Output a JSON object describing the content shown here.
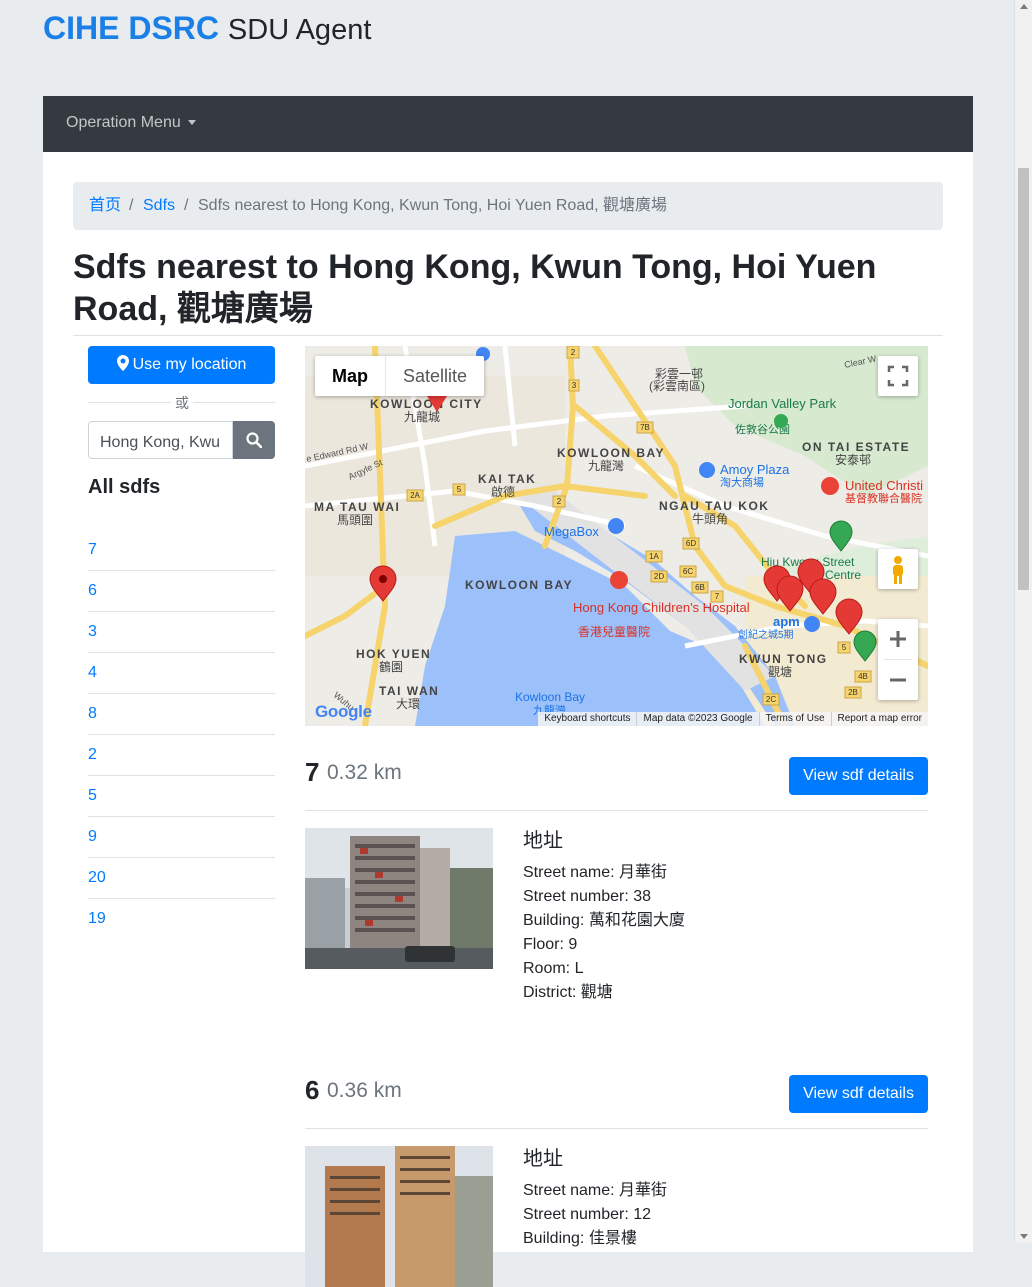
{
  "brand": {
    "primary": "CIHE DSRC",
    "secondary": "SDU Agent"
  },
  "navbar": {
    "menu_label": "Operation Menu"
  },
  "breadcrumb": {
    "home": "首页",
    "sdfs": "Sdfs",
    "current": "Sdfs nearest to Hong Kong, Kwun Tong, Hoi Yuen Road, 觀塘廣場",
    "separator": "/"
  },
  "page_title": "Sdfs nearest to Hong Kong, Kwun Tong, Hoi Yuen Road, 觀塘廣場",
  "sidebar": {
    "use_location_label": "Use my location",
    "or_label": "或",
    "search_value": "Hong Kong, Kwun Tong, Hoi Yuen Road, 觀塘廣場",
    "all_sdfs_label": "All sdfs",
    "sdf_links": [
      "7",
      "6",
      "3",
      "4",
      "8",
      "2",
      "5",
      "9",
      "20",
      "19"
    ]
  },
  "map": {
    "map_tab": "Map",
    "satellite_tab": "Satellite",
    "google_logo": "Google",
    "keyboard_shortcuts": "Keyboard shortcuts",
    "map_data": "Map data ©2023 Google",
    "terms": "Terms of Use",
    "report": "Report a map error",
    "labels": {
      "kowloon_city": "KOWLOON CITY",
      "kowloon_city_zh": "九龍城",
      "kai_tak": "KAI TAK",
      "kai_tak_zh": "啟德",
      "kowloon_bay": "KOWLOON BAY",
      "kowloon_bay_zh": "九龍灣",
      "ma_tau_wai": "MA TAU WAI",
      "ma_tau_wai_zh": "馬頭圍",
      "ngau_tau_kok": "NGAU TAU KOK",
      "ngau_tau_kok_zh": "牛頭角",
      "kowloon_bay_water": "KOWLOON BAY",
      "hok_yuen": "HOK YUEN",
      "hok_yuen_zh": "鶴園",
      "tai_wan": "TAI WAN",
      "tai_wan_zh": "大環",
      "kwun_tong": "KWUN TONG",
      "kwun_tong_zh": "觀塘",
      "on_tai_estate": "ON TAI ESTATE",
      "on_tai_estate_zh": "安泰邨",
      "jordan_valley_park": "Jordan Valley Park",
      "jordan_valley_park_zh": "佐敦谷公園",
      "amoy_plaza": "Amoy Plaza",
      "amoy_plaza_zh": "淘大商場",
      "megabox": "MegaBox",
      "hk_childrens_hospital": "Hong Kong Children's Hospital",
      "hk_childrens_hospital_zh": "香港兒童醫院",
      "apm": "apm",
      "apm_zh": "創紀之城5期",
      "united_christian": "United Christi",
      "united_christian_zh": "基督教聯合醫院",
      "hiu_kwong": "Hiu Kwong Street",
      "hiu_kwong_2": "Centre",
      "choi_wan": "彩雲一邨",
      "choi_wan_2": "(彩雲南區)",
      "kowloon_bay_lower": "Kowloon Bay",
      "kowloon_bay_lower_zh": "九龍灣",
      "edward_rd": "e Edward Rd W",
      "argyle": "Argyle St",
      "hoi_yuen": "Wuhu",
      "clear_water": "Clear W"
    },
    "road_numbers": [
      "2",
      "3",
      "2A",
      "5",
      "7B",
      "6D",
      "6C",
      "1A",
      "2D",
      "6B",
      "7",
      "5",
      "4B",
      "2B",
      "2C",
      "2"
    ]
  },
  "results": [
    {
      "name": "7",
      "distance": "0.32 km",
      "button_label": "View sdf details",
      "address_heading": "地址",
      "street_name": "Street name: 月華街",
      "street_number": "Street number: 38",
      "building": "Building: 萬和花園大廈",
      "floor": "Floor: 9",
      "room": "Room: L",
      "district": "District: 觀塘"
    },
    {
      "name": "6",
      "distance": "0.36 km",
      "button_label": "View sdf details",
      "address_heading": "地址",
      "street_name": "Street name: 月華街",
      "street_number": "Street number: 12",
      "building": "Building: 佳景樓"
    }
  ],
  "colors": {
    "primary": "#007bff",
    "navbar": "#343a40",
    "brand": "#1a7fe6",
    "page_bg": "#e9ecef",
    "marker_red": "#e53935",
    "marker_green": "#34a853"
  }
}
